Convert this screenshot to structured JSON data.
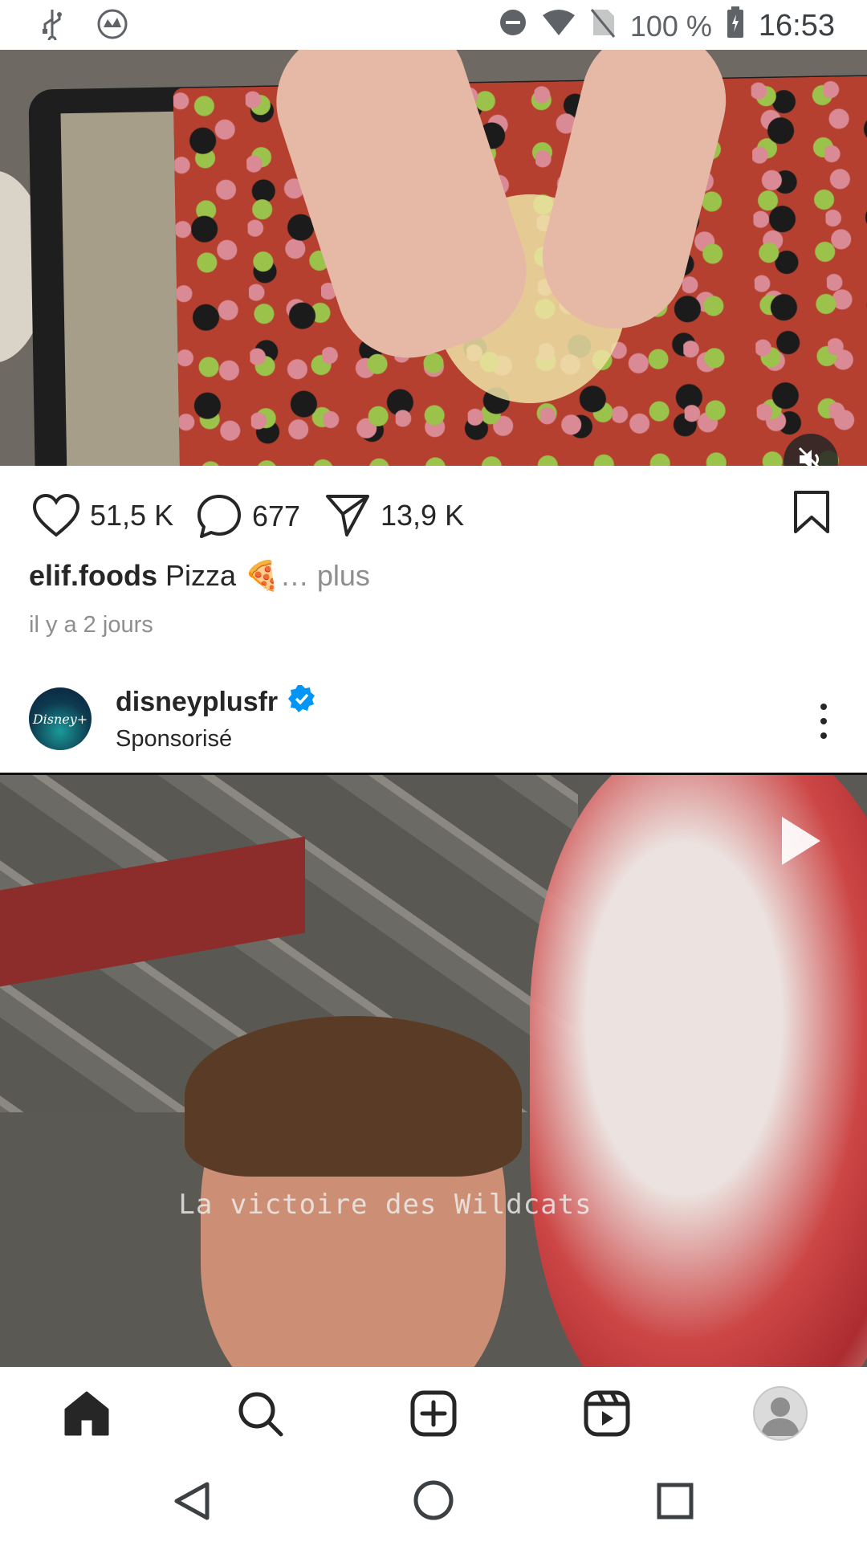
{
  "status_bar": {
    "icons": [
      "usb-icon",
      "vpn-icon",
      "dnd-icon",
      "wifi-icon",
      "no-sim-icon",
      "battery-icon"
    ],
    "battery": "100 %",
    "time": "16:53"
  },
  "post1": {
    "likes": "51,5 K",
    "comments": "677",
    "shares": "13,9 K",
    "username": "elif.foods",
    "caption": "Pizza 🍕",
    "more": "… plus",
    "timestamp": "il y a 2 jours"
  },
  "post2": {
    "username": "disneyplusfr",
    "verified": true,
    "sponsored_label": "Sponsorisé",
    "avatar_text": "Disney+",
    "video_subtitle": "La victoire des Wildcats"
  },
  "bottom_nav": {
    "items": [
      "home-icon",
      "search-icon",
      "create-icon",
      "reels-icon",
      "profile-avatar"
    ]
  },
  "system_nav": {
    "items": [
      "back-icon",
      "home-circle-icon",
      "recents-icon"
    ]
  },
  "colors": {
    "text": "#262626",
    "muted": "#8e8e8e",
    "verified": "#0095f6"
  }
}
